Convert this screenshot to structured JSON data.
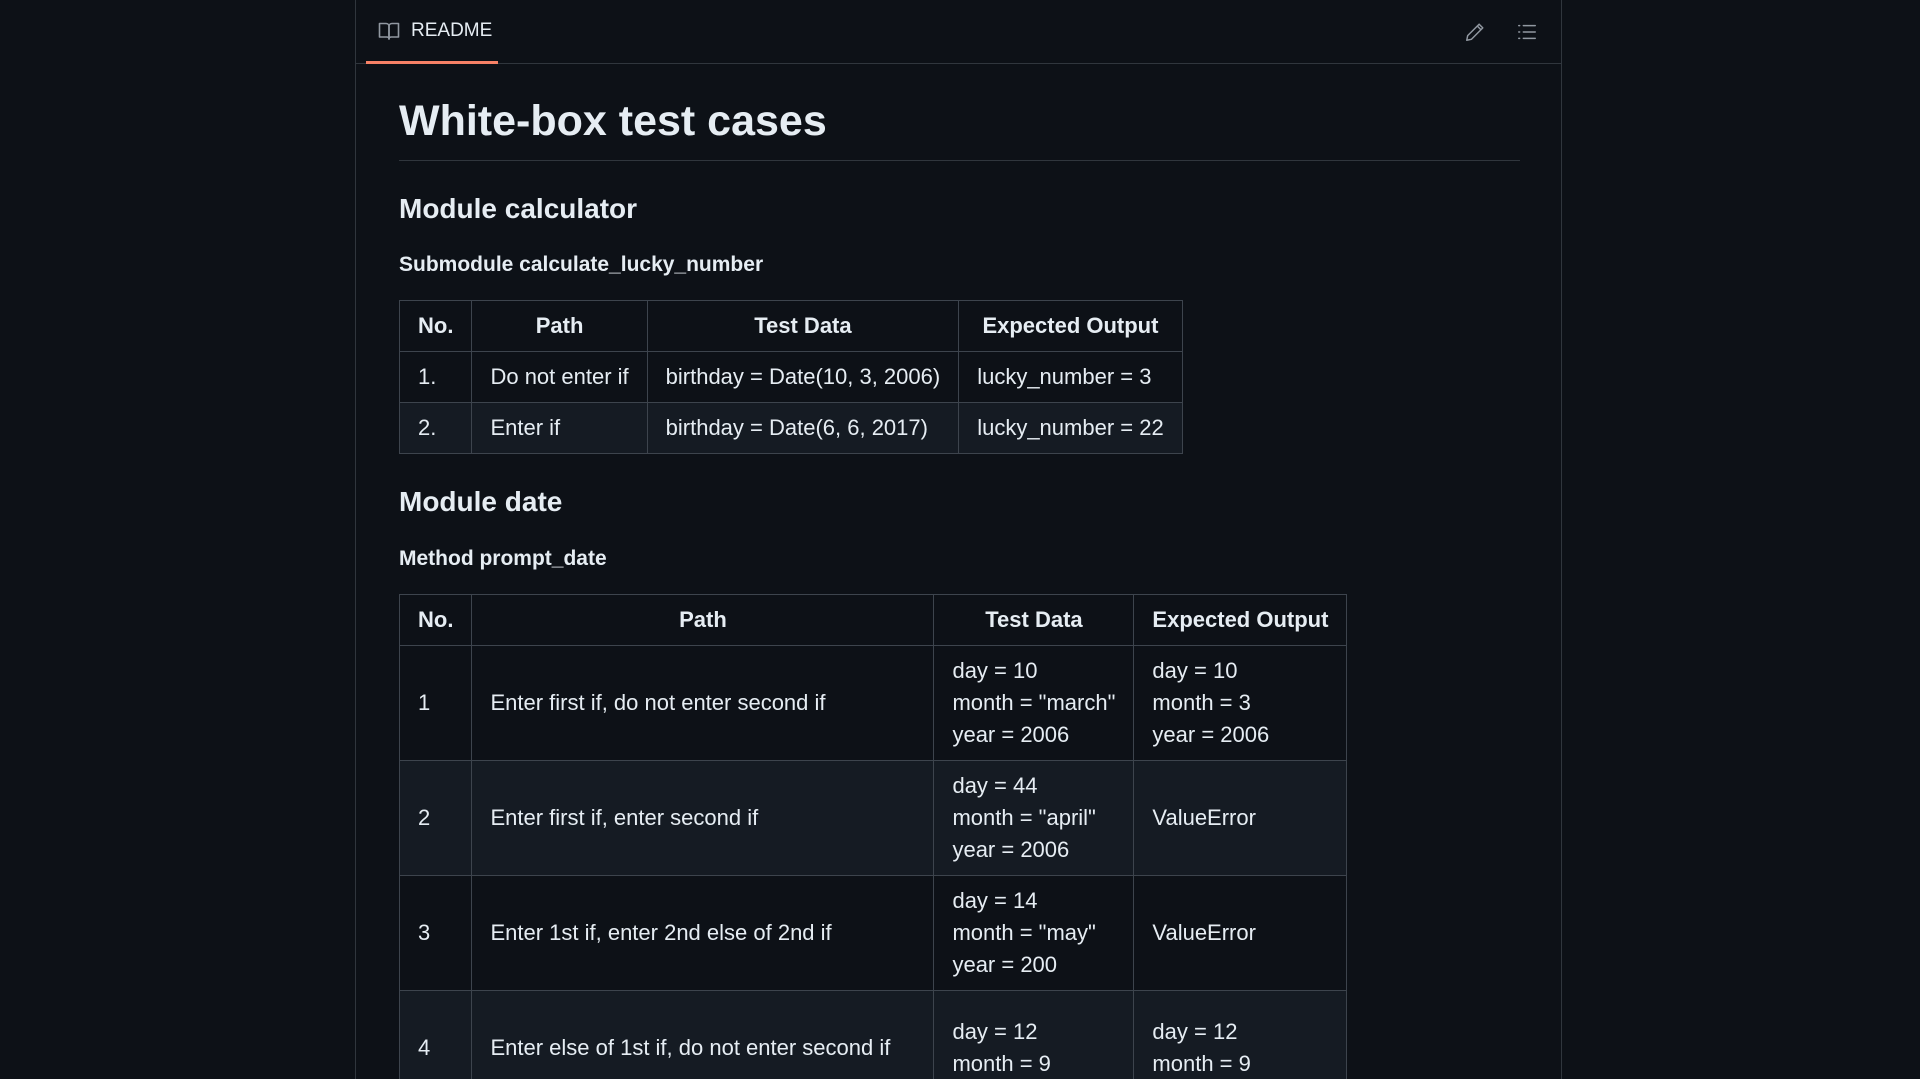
{
  "readme_tab": {
    "label": "README",
    "icon": "book-icon"
  },
  "toolbar": {
    "edit_icon": "pencil-icon",
    "toc_icon": "list-icon"
  },
  "doc": {
    "title": "White-box test cases",
    "section1": {
      "heading": "Module calculator",
      "subheading": "Submodule calculate_lucky_number",
      "table": {
        "headers": [
          "No.",
          "Path",
          "Test Data",
          "Expected Output"
        ],
        "rows": [
          [
            "1.",
            "Do not enter if",
            "birthday = Date(10, 3, 2006)",
            "lucky_number = 3"
          ],
          [
            "2.",
            "Enter if",
            "birthday = Date(6, 6, 2017)",
            "lucky_number = 22"
          ]
        ]
      }
    },
    "section2": {
      "heading": "Module date",
      "subheading": "Method prompt_date",
      "table": {
        "headers": [
          "No.",
          "Path",
          "Test Data",
          "Expected Output"
        ],
        "rows": [
          {
            "no": "1",
            "path": "Enter first if, do not enter second if",
            "data": [
              "day = 10",
              "month = \"march\"",
              "year = 2006"
            ],
            "output": [
              "day = 10",
              "month = 3",
              "year = 2006"
            ]
          },
          {
            "no": "2",
            "path": "Enter first if, enter second if",
            "data": [
              "day = 44",
              "month = \"april\"",
              "year = 2006"
            ],
            "output": [
              "ValueError"
            ]
          },
          {
            "no": "3",
            "path": "Enter 1st if, enter 2nd else of 2nd if",
            "data": [
              "day = 14",
              "month = \"may\"",
              "year = 200"
            ],
            "output": [
              "ValueError"
            ]
          },
          {
            "no": "4",
            "path": "Enter else of 1st if, do not enter second if",
            "data": [
              "day = 12",
              "month = 9"
            ],
            "output": [
              "day = 12",
              "month = 9"
            ]
          }
        ]
      }
    }
  }
}
